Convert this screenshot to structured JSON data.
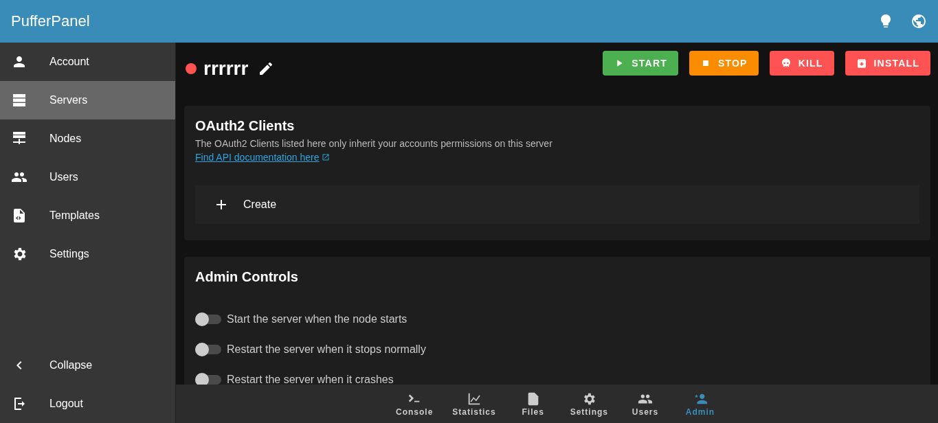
{
  "app_bar": {
    "title": "PufferPanel"
  },
  "sidebar": {
    "items": [
      {
        "label": "Account",
        "selected": false
      },
      {
        "label": "Servers",
        "selected": true
      },
      {
        "label": "Nodes",
        "selected": false
      },
      {
        "label": "Users",
        "selected": false
      },
      {
        "label": "Templates",
        "selected": false
      },
      {
        "label": "Settings",
        "selected": false
      }
    ],
    "footer_items": [
      {
        "label": "Collapse"
      },
      {
        "label": "Logout"
      }
    ]
  },
  "server": {
    "name": "rrrrrr",
    "color": "#ff5252"
  },
  "actions": [
    {
      "kind": "start",
      "label": "START"
    },
    {
      "kind": "stop",
      "label": "STOP"
    },
    {
      "kind": "kill",
      "label": "KILL"
    },
    {
      "kind": "install",
      "label": "INSTALL"
    }
  ],
  "oauth_card": {
    "title": "OAuth2 Clients",
    "description": "The OAuth2 Clients listed here only inherit your accounts permissions on this server",
    "link": "Find API documentation here",
    "create": "Create"
  },
  "admin_card": {
    "title": "Admin Controls",
    "toggles": [
      {
        "label": "Start the server when the node starts",
        "on": false
      },
      {
        "label": "Restart the server when it stops normally",
        "on": false
      },
      {
        "label": "Restart the server when it crashes",
        "on": false
      }
    ]
  },
  "bottom_nav": [
    {
      "label": "Console",
      "selected": false
    },
    {
      "label": "Statistics",
      "selected": false
    },
    {
      "label": "Files",
      "selected": false
    },
    {
      "label": "Settings",
      "selected": false
    },
    {
      "label": "Users",
      "selected": false
    },
    {
      "label": "Admin",
      "selected": true
    }
  ]
}
